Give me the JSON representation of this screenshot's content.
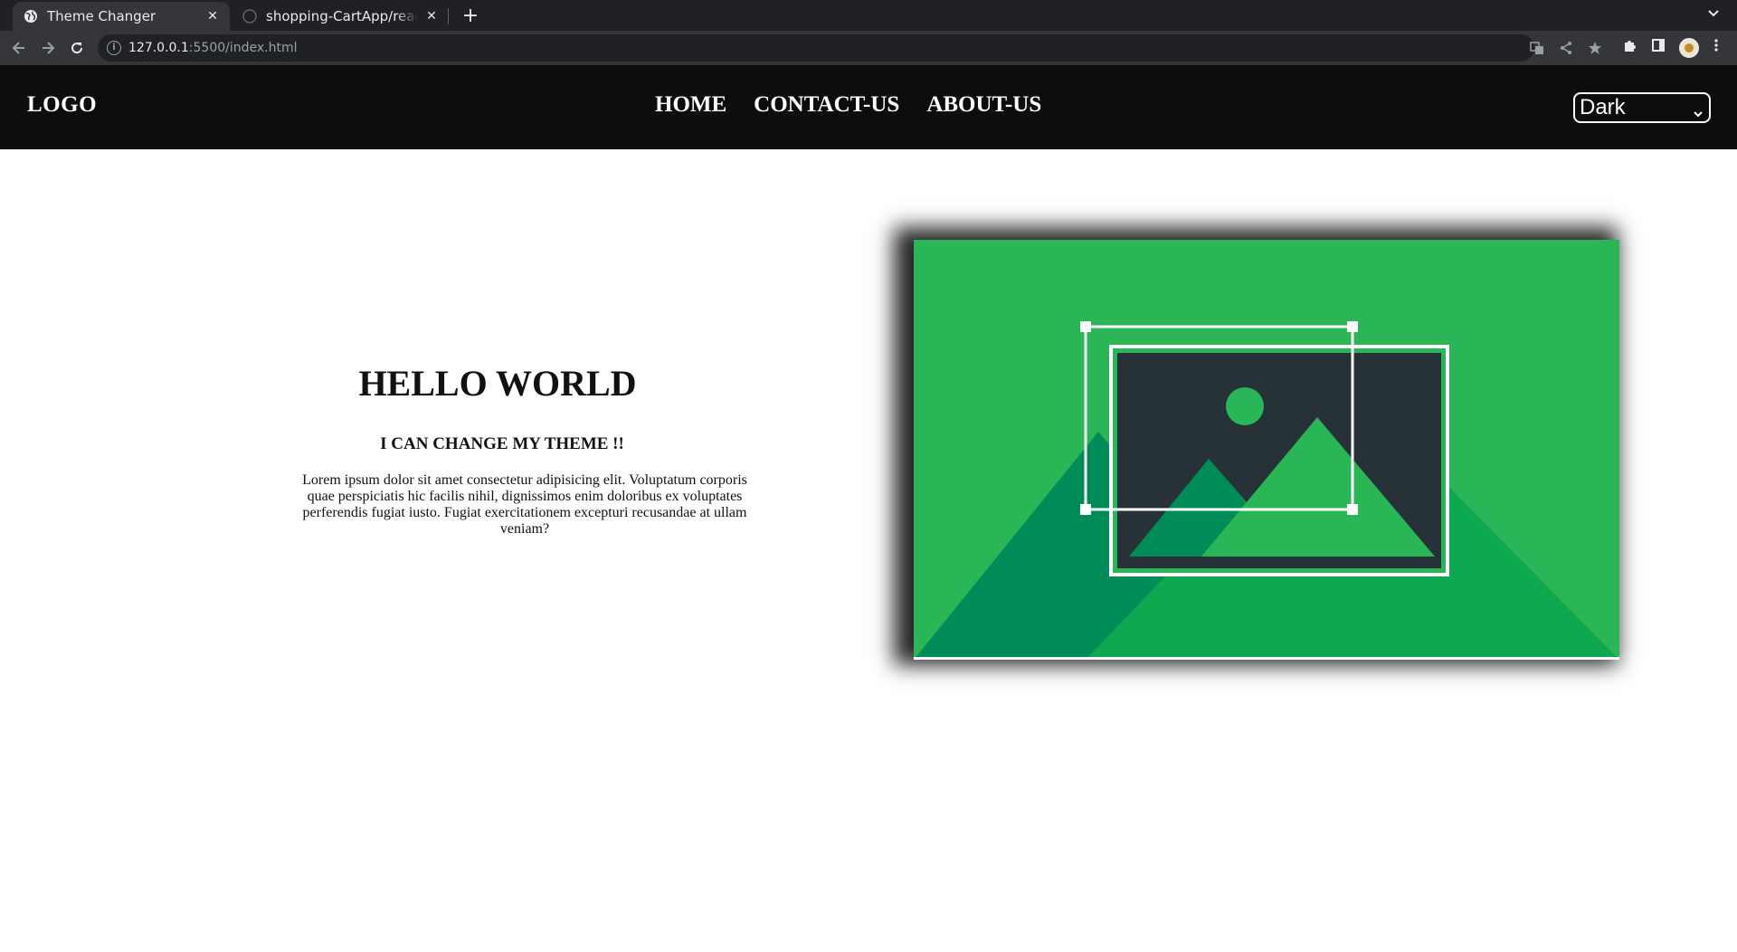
{
  "browser": {
    "tabs": [
      {
        "title": "Theme Changer",
        "active": true
      },
      {
        "title": "shopping-CartApp/readme",
        "active": false
      }
    ],
    "url_host": "127.0.0.1",
    "url_rest": ":5500/index.html",
    "new_tab_symbol": "+",
    "tab_close_symbol": "✕"
  },
  "site": {
    "logo": "LOGO",
    "nav": {
      "home": "HOME",
      "contact": "CONTACT-US",
      "about": "ABOUT-US"
    },
    "theme_selector": {
      "selected": "Dark"
    }
  },
  "hero": {
    "title": "HELLO WORLD",
    "subtitle": "I CAN CHANGE MY THEME !!",
    "body": "Lorem ipsum dolor sit amet consectetur adipisicing elit. Voluptatum corporis quae perspiciatis hic facilis nihil, dignissimos enim doloribus ex voluptates perferendis fugiat iusto. Fugiat exercitationem excepturi recusandae at ullam veniam?"
  },
  "colors": {
    "header_bg": "#0d0d0d",
    "illustration_green": "#2ab656",
    "illustration_dark_green": "#008c58",
    "illustration_mid_green": "#0ea850",
    "illustration_frame": "#263238"
  }
}
